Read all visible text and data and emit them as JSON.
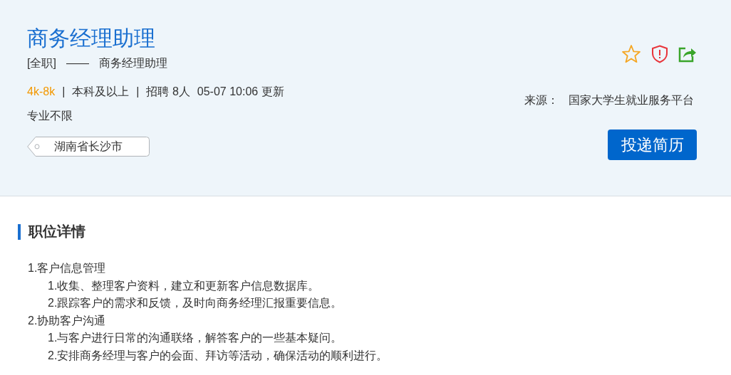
{
  "job": {
    "title": "商务经理助理",
    "subtitle": [
      "[全职]",
      "——",
      "商务经理助理"
    ],
    "meta": [
      {
        "kind": "salary",
        "text": "4k-8k"
      },
      {
        "kind": "separator",
        "text": "|"
      },
      {
        "kind": "text",
        "text": "本科及以上"
      },
      {
        "kind": "separator",
        "text": "|"
      },
      {
        "kind": "text",
        "text": "招聘 8人"
      },
      {
        "kind": "text",
        "text": "05-07 10:06 更新"
      }
    ],
    "major": "专业不限",
    "location": "湖南省长沙市",
    "source_label": "来源：",
    "source": "国家大学生就业服务平台",
    "apply_button": "投递简历"
  },
  "details": {
    "heading": "职位详情",
    "items": [
      {
        "text": "1.客户信息管理",
        "children": [
          {
            "text": "1.收集、整理客户资料，建立和更新客户信息数据库。"
          },
          {
            "text": "2.跟踪客户的需求和反馈，及时向商务经理汇报重要信息。"
          }
        ]
      },
      {
        "text": "2.协助客户沟通",
        "children": [
          {
            "text": "1.与客户进行日常的沟通联络，解答客户的一些基本疑问。"
          },
          {
            "text": "2.安排商务经理与客户的会面、拜访等活动，确保活动的顺利进行。"
          }
        ]
      }
    ]
  }
}
